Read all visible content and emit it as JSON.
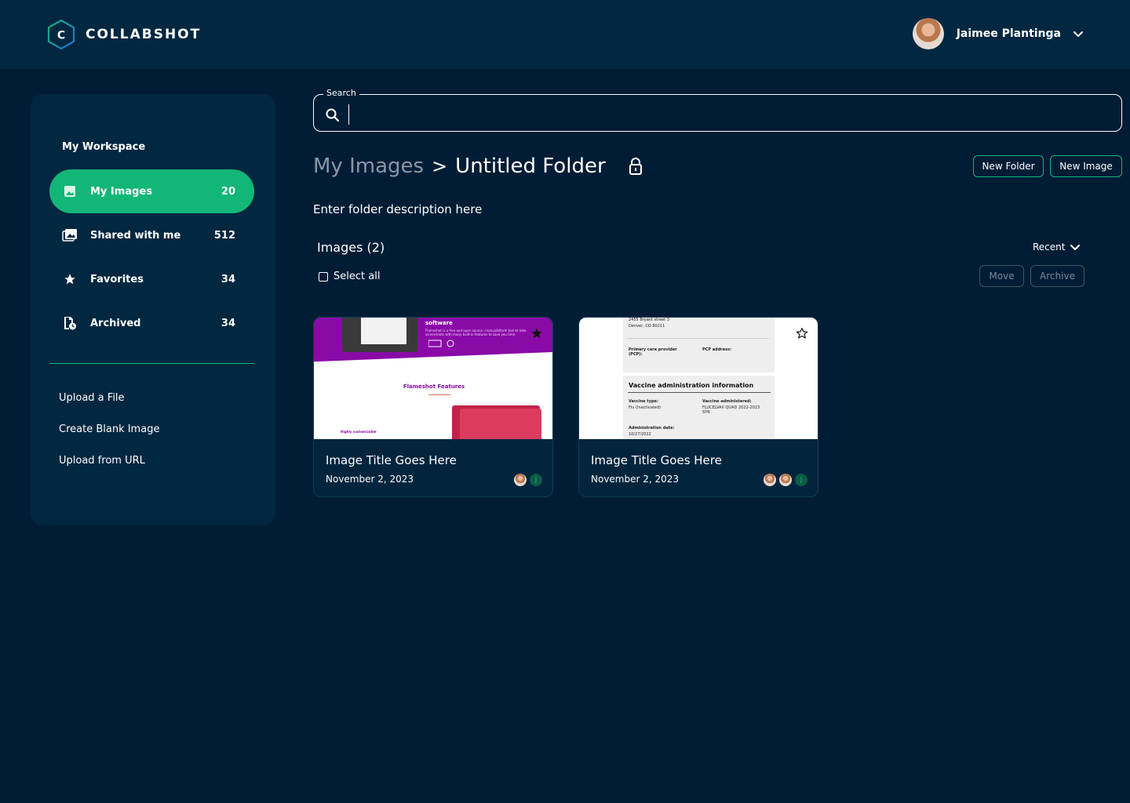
{
  "brand": {
    "name": "COLLABSHOT"
  },
  "user": {
    "name": "Jaimee Plantinga"
  },
  "sidebar": {
    "workspace_title": "My Workspace",
    "items": [
      {
        "label": "My Images",
        "count": "20",
        "icon": "image-icon",
        "active": true
      },
      {
        "label": "Shared with me",
        "count": "512",
        "icon": "shared-images-icon",
        "active": false
      },
      {
        "label": "Favorites",
        "count": "34",
        "icon": "star-icon",
        "active": false
      },
      {
        "label": "Archived",
        "count": "34",
        "icon": "archive-icon",
        "active": false
      }
    ],
    "actions": [
      "Upload a File",
      "Create Blank Image",
      "Upload from URL"
    ]
  },
  "search": {
    "label": "Search",
    "value": ""
  },
  "breadcrumb": {
    "parent": "My Images",
    "separator": ">",
    "current": "Untitled Folder"
  },
  "toolbar": {
    "new_folder": "New Folder",
    "new_image": "New Image"
  },
  "folder": {
    "description": "Enter folder description here"
  },
  "images_section": {
    "count_label": "Images (2)",
    "sort_label": "Recent",
    "select_all": "Select all",
    "move": "Move",
    "archive": "Archive"
  },
  "cards": [
    {
      "title": "Image Title Goes Here",
      "date": "November 2, 2023",
      "favorited": true,
      "thumbnail": {
        "heading": "software",
        "body": "Flameshot is a free and open-source, cross-platform tool to take screenshots with many built-in features to save you time.",
        "section": "Flameshot Features",
        "small": "Highly customizable"
      }
    },
    {
      "title": "Image Title Goes Here",
      "date": "November 2, 2023",
      "favorited": false,
      "thumbnail": {
        "address1": "2455 Bryant street 3",
        "address2": "Denver, CO 80211",
        "pcp_label": "Primary care provider (PCP):",
        "pcp_address_label": "PCP address:",
        "section": "Vaccine administration information",
        "vaccine_type_label": "Vaccine type:",
        "vaccine_type": "Flu (Inactivated)",
        "vaccine_admin_label": "Vaccine administered:",
        "vaccine_admin": "FLUCELVAX QUAD 2022-2023 SYR",
        "admin_date_label": "Administration date:",
        "admin_date": "10/27/2022"
      }
    }
  ],
  "colors": {
    "background": "#011d36",
    "panel": "#022740",
    "accent": "#12b677"
  }
}
